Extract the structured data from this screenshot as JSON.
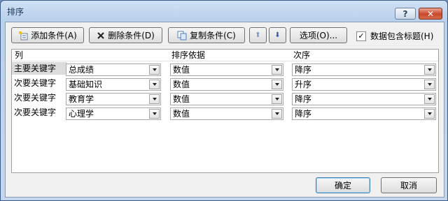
{
  "window": {
    "title": "排序"
  },
  "titlebar": {
    "help_glyph": "?",
    "close_glyph": "✕"
  },
  "toolbar": {
    "add_label": "添加条件(A)",
    "delete_label": "删除条件(D)",
    "copy_label": "复制条件(C)",
    "options_label": "选项(O)...",
    "header_checkbox_label": "数据包含标题(H)",
    "header_checkbox_checked": true,
    "up_glyph": "⬆",
    "down_glyph": "⬇"
  },
  "columns": {
    "column": "列",
    "sort_on": "排序依据",
    "order": "次序"
  },
  "rows": [
    {
      "label": "主要关键字",
      "column": "总成绩",
      "sort_on": "数值",
      "order": "降序"
    },
    {
      "label": "次要关键字",
      "column": "基础知识",
      "sort_on": "数值",
      "order": "升序"
    },
    {
      "label": "次要关键字",
      "column": "教育学",
      "sort_on": "数值",
      "order": "降序"
    },
    {
      "label": "次要关键字",
      "column": "心理学",
      "sort_on": "数值",
      "order": "降序"
    }
  ],
  "buttons": {
    "ok": "确定",
    "cancel": "取消"
  },
  "colors": {
    "title_text": "#1e395b",
    "close_button": "#c9472b",
    "accent_border": "#3c7fb1"
  }
}
